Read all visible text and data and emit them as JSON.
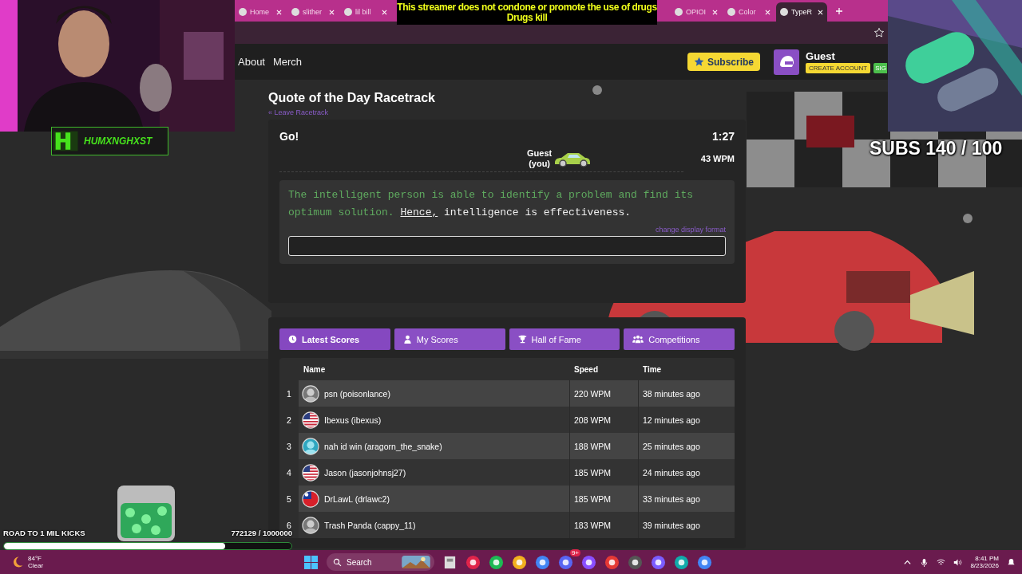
{
  "browser": {
    "tabs": [
      {
        "title": "Home",
        "selected": false
      },
      {
        "title": "slither",
        "selected": false
      },
      {
        "title": "lil bill",
        "selected": false
      },
      {
        "title": "OPIOI",
        "selected": false
      },
      {
        "title": "Color",
        "selected": false
      },
      {
        "title": "TypeR",
        "selected": true
      }
    ]
  },
  "site_header": {
    "nav": [
      "About",
      "Merch"
    ],
    "subscribe_button": "Subscribe",
    "user": {
      "name": "Guest",
      "create_account": "CREATE ACCOUNT",
      "sign_in": "SIG"
    }
  },
  "race": {
    "title": "Quote of the Day Racetrack",
    "leave_link": "« Leave Racetrack",
    "status": "Go!",
    "timer": "1:27",
    "racer": {
      "name": "Guest",
      "note": "(you)"
    },
    "wpm": "43 WPM",
    "quote": {
      "typed": "The intelligent person is able to identify a problem and find its optimum solution.",
      "current_word": "Hence,",
      "remaining": "intelligence is effectiveness."
    },
    "display_format_link": "change display format"
  },
  "scores": {
    "tabs": [
      {
        "label": "Latest Scores",
        "selected": true
      },
      {
        "label": "My Scores",
        "selected": false
      },
      {
        "label": "Hall of Fame",
        "selected": false
      },
      {
        "label": "Competitions",
        "selected": false
      }
    ],
    "columns": [
      "Name",
      "Speed",
      "Time"
    ],
    "rows": [
      {
        "rank": "1",
        "name": "psn (poisonlance)",
        "speed": "220 WPM",
        "time": "38 minutes ago"
      },
      {
        "rank": "2",
        "kind": "us-flag",
        "name": "Ibexus (ibexus)",
        "speed": "208 WPM",
        "time": "12 minutes ago"
      },
      {
        "rank": "3",
        "name": "nah id win (aragorn_the_snake)",
        "speed": "188 WPM",
        "time": "25 minutes ago"
      },
      {
        "rank": "4",
        "kind": "us-flag",
        "name": "Jason (jasonjohnsj27)",
        "speed": "185 WPM",
        "time": "24 minutes ago"
      },
      {
        "rank": "5",
        "kind": "tw-flag",
        "name": "DrLawL (drlawc2)",
        "speed": "185 WPM",
        "time": "33 minutes ago"
      },
      {
        "rank": "6",
        "name": "Trash Panda (cappy_11)",
        "speed": "183 WPM",
        "time": "39 minutes ago"
      }
    ]
  },
  "stream_overlay": {
    "banner": [
      "This streamer does not condone or promote the use of drugs",
      "Drugs kill"
    ],
    "channel_name": "HUMXNGHXST",
    "subs_goal": "SUBS 140 / 100",
    "kick_goal": {
      "label": "ROAD TO 1 MIL KICKS",
      "count": "772129 / 1000000",
      "level": 0.77
    }
  },
  "taskbar": {
    "weather": {
      "temperature": "84°F",
      "condition": "Clear"
    },
    "search_placeholder": "Search",
    "notification_badge": "9+",
    "time": "8:41 PM",
    "date": "8/23/2026"
  }
}
